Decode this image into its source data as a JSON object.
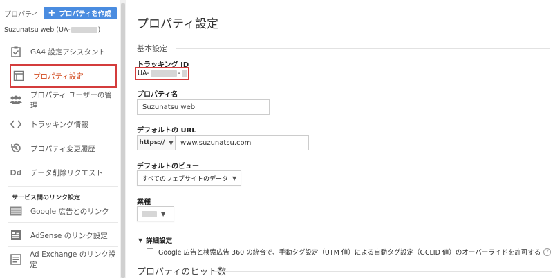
{
  "sidebar": {
    "property_label": "プロパティ",
    "create_button": "プロパティを作成",
    "account_name": "Suzunatsu web (UA-",
    "account_suffix": ")",
    "items": [
      {
        "label": "GA4 設定アシスタント",
        "icon": "checklist-icon"
      },
      {
        "label": "プロパティ設定",
        "icon": "property-window-icon",
        "active": true
      },
      {
        "label": "プロパティ ユーザーの管理",
        "icon": "users-icon"
      },
      {
        "label": "トラッキング情報",
        "icon": "code-icon"
      },
      {
        "label": "プロパティ変更履歴",
        "icon": "history-icon"
      },
      {
        "label": "データ削除リクエスト",
        "icon": "dd-icon"
      }
    ],
    "link_section_title": "サービス間のリンク設定",
    "link_items": [
      {
        "label": "Google 広告とのリンク",
        "icon": "ads-icon"
      },
      {
        "label": "AdSense のリンク設定",
        "icon": "adsense-icon"
      },
      {
        "label": "Ad Exchange のリンク設定",
        "icon": "adexchange-icon"
      }
    ]
  },
  "main": {
    "title": "プロパティ設定",
    "basic_section": "基本設定",
    "tracking_id_label": "トラッキング ID",
    "tracking_id_prefix": "UA-",
    "tracking_id_sep": "-",
    "property_name_label": "プロパティ名",
    "property_name_value": "Suzunatsu web",
    "default_url_label": "デフォルトの URL",
    "url_protocol": "https://",
    "url_value": "www.suzunatsu.com",
    "default_view_label": "デフォルトのビュー",
    "default_view_value": "すべてのウェブサイトのデータ",
    "industry_label": "業種",
    "advanced_label": "詳細設定",
    "checkbox_text": "Google 広告と検索広告 360 の統合で、手動タグ設定（UTM 値）による自動タグ設定（GCLID 値）のオーバーライドを許可する",
    "help": "?",
    "hits_section": "プロパティのヒット数"
  },
  "colors": {
    "accent_blue": "#4a8ce0",
    "highlight_red": "#d43c3c",
    "active_text": "#d24a1f"
  }
}
